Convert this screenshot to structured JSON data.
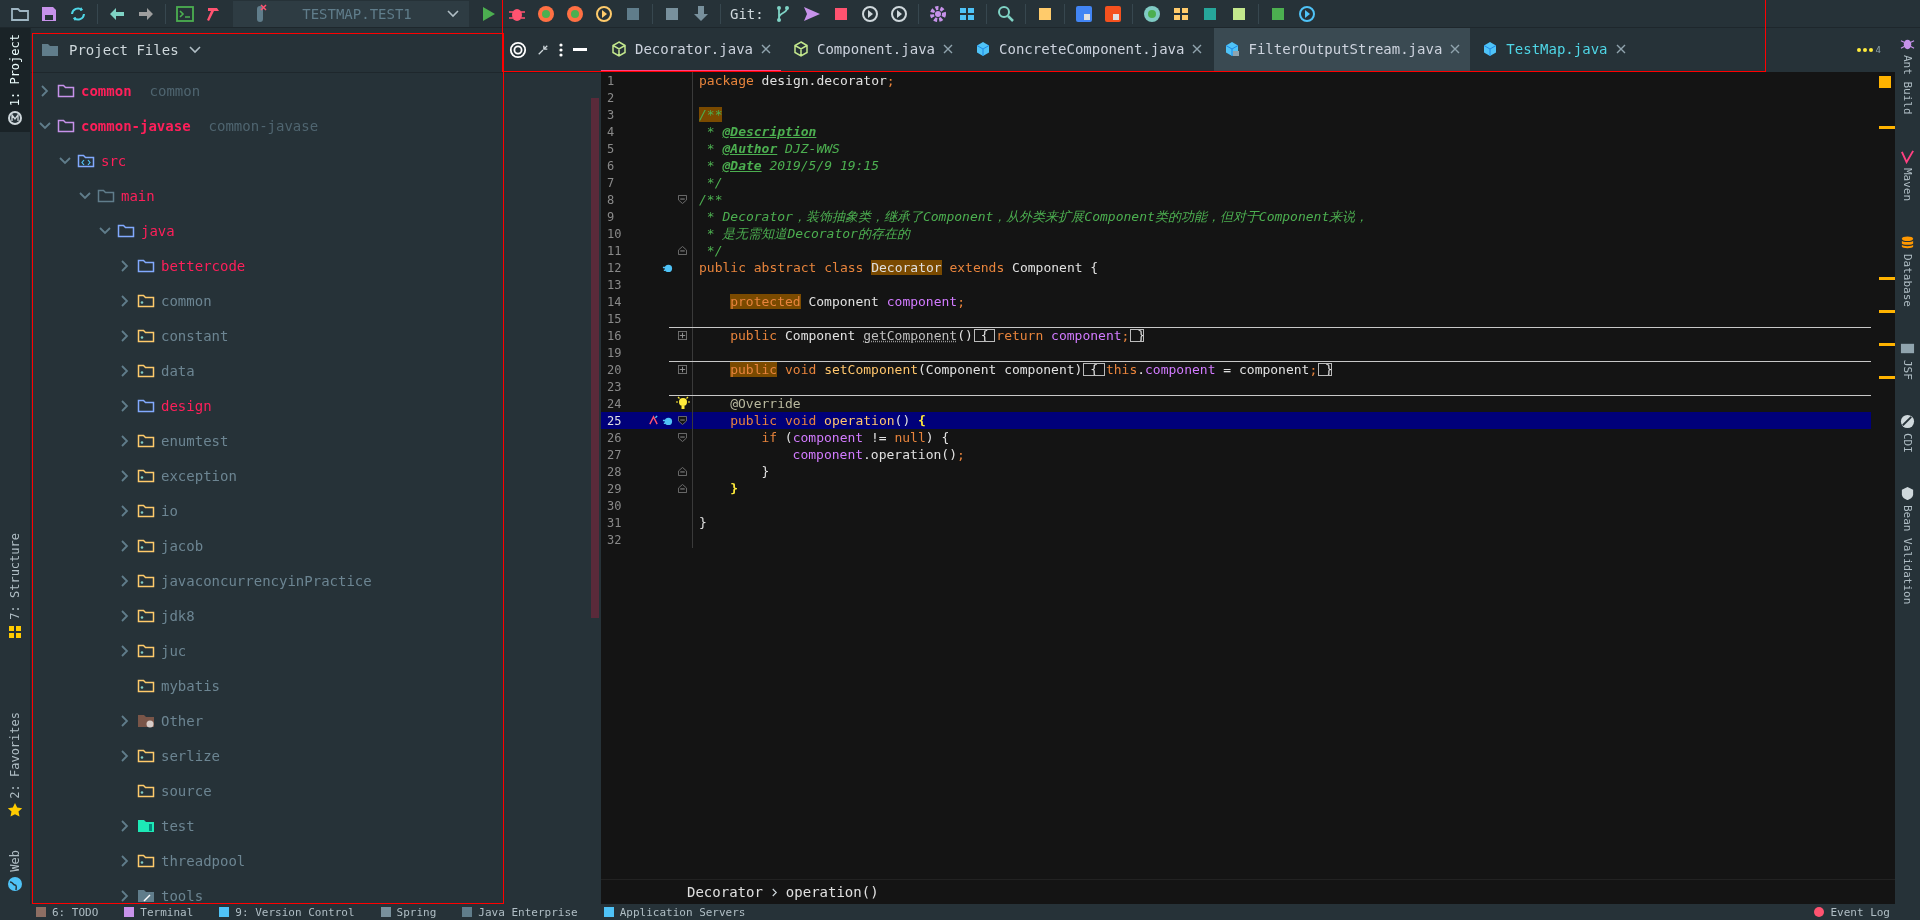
{
  "toolbar": {
    "run_config": "TESTMAP.TEST1",
    "git_label": "Git:"
  },
  "left_tool_tabs": [
    {
      "label": "1: Project",
      "kind": "project",
      "selected": true
    },
    {
      "label": "7: Structure",
      "kind": "structure",
      "selected": false
    },
    {
      "label": "2: Favorites",
      "kind": "favorites",
      "selected": false
    },
    {
      "label": "Web",
      "kind": "web",
      "selected": false
    }
  ],
  "project_panel": {
    "title": "Project Files",
    "tree": [
      {
        "name": "common",
        "module": "common",
        "kind": "module",
        "modified": true,
        "expanded": false
      },
      {
        "name": "common-javase",
        "module": "common-javase",
        "kind": "module",
        "modified": true,
        "expanded": true,
        "children": [
          {
            "name": "src",
            "kind": "src",
            "modified": true,
            "expanded": true,
            "children": [
              {
                "name": "main",
                "kind": "plain",
                "modified": true,
                "expanded": true,
                "children": [
                  {
                    "name": "java",
                    "kind": "source",
                    "modified": true,
                    "expanded": true,
                    "children": [
                      {
                        "name": "bettercode",
                        "kind": "source",
                        "modified": true,
                        "expanded": false
                      },
                      {
                        "name": "common",
                        "kind": "package",
                        "modified": false,
                        "expanded": false
                      },
                      {
                        "name": "constant",
                        "kind": "package",
                        "modified": false,
                        "expanded": false
                      },
                      {
                        "name": "data",
                        "kind": "package",
                        "modified": false,
                        "expanded": false
                      },
                      {
                        "name": "design",
                        "kind": "source",
                        "modified": true,
                        "expanded": false
                      },
                      {
                        "name": "enumtest",
                        "kind": "package",
                        "modified": false,
                        "expanded": false
                      },
                      {
                        "name": "exception",
                        "kind": "package",
                        "modified": false,
                        "expanded": false
                      },
                      {
                        "name": "io",
                        "kind": "package",
                        "modified": false,
                        "expanded": false
                      },
                      {
                        "name": "jacob",
                        "kind": "package",
                        "modified": false,
                        "expanded": false
                      },
                      {
                        "name": "javaconcurrencyinPractice",
                        "kind": "package",
                        "modified": false,
                        "expanded": false
                      },
                      {
                        "name": "jdk8",
                        "kind": "package",
                        "modified": false,
                        "expanded": false
                      },
                      {
                        "name": "juc",
                        "kind": "package",
                        "modified": false,
                        "expanded": false
                      },
                      {
                        "name": "mybatis",
                        "kind": "package",
                        "modified": false
                      },
                      {
                        "name": "Other",
                        "kind": "other",
                        "modified": false,
                        "expanded": false
                      },
                      {
                        "name": "serlize",
                        "kind": "package",
                        "modified": false,
                        "expanded": false
                      },
                      {
                        "name": "source",
                        "kind": "package",
                        "modified": false
                      },
                      {
                        "name": "test",
                        "kind": "test",
                        "modified": false,
                        "expanded": false
                      },
                      {
                        "name": "threadpool",
                        "kind": "package",
                        "modified": false,
                        "expanded": false
                      },
                      {
                        "name": "tools",
                        "kind": "tools",
                        "modified": false,
                        "expanded": false
                      }
                    ]
                  }
                ]
              }
            ]
          }
        ]
      }
    ]
  },
  "editor": {
    "tabs": [
      {
        "label": "Decorator.java",
        "kind": "abstract",
        "color": "#cdd3de",
        "selected": true,
        "hovered": false
      },
      {
        "label": "Component.java",
        "kind": "abstract",
        "color": "#cdd3de",
        "selected": false,
        "hovered": false
      },
      {
        "label": "ConcreteComponent.java",
        "kind": "class",
        "color": "#cdd3de",
        "selected": false,
        "hovered": false
      },
      {
        "label": "FilterOutputStream.java",
        "kind": "compiled",
        "color": "#cdd3de",
        "selected": false,
        "hovered": true
      },
      {
        "label": "TestMap.java",
        "kind": "class",
        "color": "#4fd6e6",
        "selected": false,
        "hovered": false
      }
    ],
    "hidden_tabs": "4",
    "lines": [
      {
        "number": "1",
        "kind": "top",
        "segments": [
          {
            "kind": "keyword",
            "text": "package"
          },
          {
            "kind": "plain",
            "text": " design.decorator"
          },
          {
            "kind": "keyword",
            "text": ";"
          }
        ]
      },
      {
        "number": "2"
      },
      {
        "number": "3",
        "kind": "top",
        "segments": [
          {
            "kind": "comment",
            "text": "/**",
            "highlight": true
          }
        ]
      },
      {
        "number": "4",
        "kind": "top",
        "segments": [
          {
            "kind": "comment",
            "text": " * "
          },
          {
            "kind": "doctag",
            "text": "@Description"
          }
        ]
      },
      {
        "number": "5",
        "kind": "top",
        "segments": [
          {
            "kind": "comment",
            "text": " * "
          },
          {
            "kind": "doctag",
            "text": "@Author"
          },
          {
            "kind": "comment",
            "text": " DJZ-WWS"
          }
        ]
      },
      {
        "number": "6",
        "kind": "top",
        "segments": [
          {
            "kind": "comment",
            "text": " * "
          },
          {
            "kind": "doctag",
            "text": "@Date"
          },
          {
            "kind": "comment",
            "text": " 2019/5/9 19:15"
          }
        ]
      },
      {
        "number": "7",
        "kind": "top",
        "segments": [
          {
            "kind": "comment",
            "text": " */"
          }
        ]
      },
      {
        "number": "8",
        "kind": "top",
        "fold": {
          "kind": "start"
        },
        "segments": [
          {
            "kind": "comment",
            "text": "/**"
          }
        ]
      },
      {
        "number": "9",
        "kind": "top",
        "segments": [
          {
            "kind": "comment",
            "text": " * Decorator，装饰抽象类，继承了Component，从外类来扩展Component类的功能，但对于Component来说，"
          }
        ]
      },
      {
        "number": "10",
        "kind": "top",
        "segments": [
          {
            "kind": "comment",
            "text": " * 是无需知道Decorator的存在的"
          }
        ]
      },
      {
        "number": "11",
        "kind": "top",
        "fold": {
          "kind": "end"
        },
        "segments": [
          {
            "kind": "comment",
            "text": " */"
          }
        ]
      },
      {
        "number": "12",
        "kind": "top",
        "markers": [
          {
            "kind": "implemented"
          }
        ],
        "segments": [
          {
            "kind": "keyword",
            "text": "public abstract class "
          },
          {
            "kind": "plain",
            "text": "Decorator",
            "highlight": true
          },
          {
            "kind": "keyword",
            "text": " extends "
          },
          {
            "kind": "plain",
            "text": "Component {"
          }
        ]
      },
      {
        "number": "13"
      },
      {
        "number": "14",
        "kind": "member",
        "segments": [
          {
            "kind": "keyword",
            "text": "protected",
            "highlight": true
          },
          {
            "kind": "plain",
            "text": " Component "
          },
          {
            "kind": "field",
            "text": "component"
          },
          {
            "kind": "keyword",
            "text": ";"
          }
        ]
      },
      {
        "number": "15"
      },
      {
        "number": "16",
        "kind": "member",
        "separator": true,
        "fold": {
          "kind": "collapsed"
        },
        "segments": [
          {
            "kind": "keyword",
            "text": "public"
          },
          {
            "kind": "plain",
            "text": " Component "
          },
          {
            "kind": "unused",
            "text": "getComponent"
          },
          {
            "kind": "plain",
            "text": "()"
          },
          {
            "kind": "folded",
            "text": " { "
          },
          {
            "kind": "keyword",
            "text": "return"
          },
          {
            "kind": "field",
            "text": " component"
          },
          {
            "kind": "keyword",
            "text": ";"
          },
          {
            "kind": "folded",
            "text": " }"
          }
        ]
      },
      {
        "number": "19"
      },
      {
        "number": "20",
        "kind": "member",
        "separator": true,
        "fold": {
          "kind": "collapsed"
        },
        "segments": [
          {
            "kind": "keyword",
            "text": "public",
            "highlight": true
          },
          {
            "kind": "keyword",
            "text": " void "
          },
          {
            "kind": "method",
            "text": "setComponent"
          },
          {
            "kind": "plain",
            "text": "(Component component)"
          },
          {
            "kind": "folded",
            "text": " { "
          },
          {
            "kind": "keyword",
            "text": "this"
          },
          {
            "kind": "plain",
            "text": "."
          },
          {
            "kind": "field",
            "text": "component"
          },
          {
            "kind": "plain",
            "text": " = component"
          },
          {
            "kind": "keyword",
            "text": ";"
          },
          {
            "kind": "folded",
            "text": " }"
          }
        ]
      },
      {
        "number": "23"
      },
      {
        "number": "24",
        "kind": "member",
        "separator": true,
        "intention": true,
        "segments": [
          {
            "kind": "annotation",
            "text": "@Override"
          }
        ]
      },
      {
        "number": "25",
        "kind": "member",
        "current": true,
        "fold": {
          "kind": "start"
        },
        "markers": [
          {
            "kind": "overrides"
          },
          {
            "kind": "implemented"
          }
        ],
        "segments": [
          {
            "kind": "keyword",
            "text": "public void "
          },
          {
            "kind": "method",
            "text": "operation"
          },
          {
            "kind": "plain",
            "text": "() "
          },
          {
            "kind": "brace",
            "text": "{"
          }
        ]
      },
      {
        "number": "26",
        "kind": "statement",
        "fold": {
          "kind": "start"
        },
        "segments": [
          {
            "kind": "keyword",
            "text": "if"
          },
          {
            "kind": "plain",
            "text": " ("
          },
          {
            "kind": "field",
            "text": "component"
          },
          {
            "kind": "plain",
            "text": " != "
          },
          {
            "kind": "keyword",
            "text": "null"
          },
          {
            "kind": "plain",
            "text": ") {"
          }
        ]
      },
      {
        "number": "27",
        "kind": "nested",
        "segments": [
          {
            "kind": "field",
            "text": "component"
          },
          {
            "kind": "plain",
            "text": ".operation()"
          },
          {
            "kind": "keyword",
            "text": ";"
          }
        ]
      },
      {
        "number": "28",
        "kind": "statement",
        "fold": {
          "kind": "end"
        },
        "segments": [
          {
            "kind": "plain",
            "text": "}"
          }
        ]
      },
      {
        "number": "29",
        "kind": "member",
        "fold": {
          "kind": "end"
        },
        "segments": [
          {
            "kind": "brace",
            "text": "}"
          }
        ]
      },
      {
        "number": "30"
      },
      {
        "number": "31",
        "kind": "top",
        "segments": [
          {
            "kind": "plain",
            "text": "}"
          }
        ]
      },
      {
        "number": "32"
      }
    ],
    "breadcrumb": [
      "Decorator",
      "operation()"
    ]
  },
  "right_tool_tabs": [
    {
      "label": "Ant Build",
      "kind": "ant"
    },
    {
      "label": "Maven",
      "kind": "maven"
    },
    {
      "label": "Database",
      "kind": "database"
    },
    {
      "label": "JSF",
      "kind": "jsf"
    },
    {
      "label": "CDI",
      "kind": "cdi"
    },
    {
      "label": "Bean Validation",
      "kind": "bean"
    }
  ],
  "bottom_tool_tabs": [
    {
      "label": "6: TODO",
      "kind": "todo"
    },
    {
      "label": "Terminal",
      "kind": "terminal"
    },
    {
      "label": "9: Version Control",
      "kind": "vcs"
    },
    {
      "label": "Spring",
      "kind": "spring"
    },
    {
      "label": "Java Enterprise",
      "kind": "javaee"
    },
    {
      "label": "Application Servers",
      "kind": "server"
    }
  ],
  "event_log": "Event Log"
}
